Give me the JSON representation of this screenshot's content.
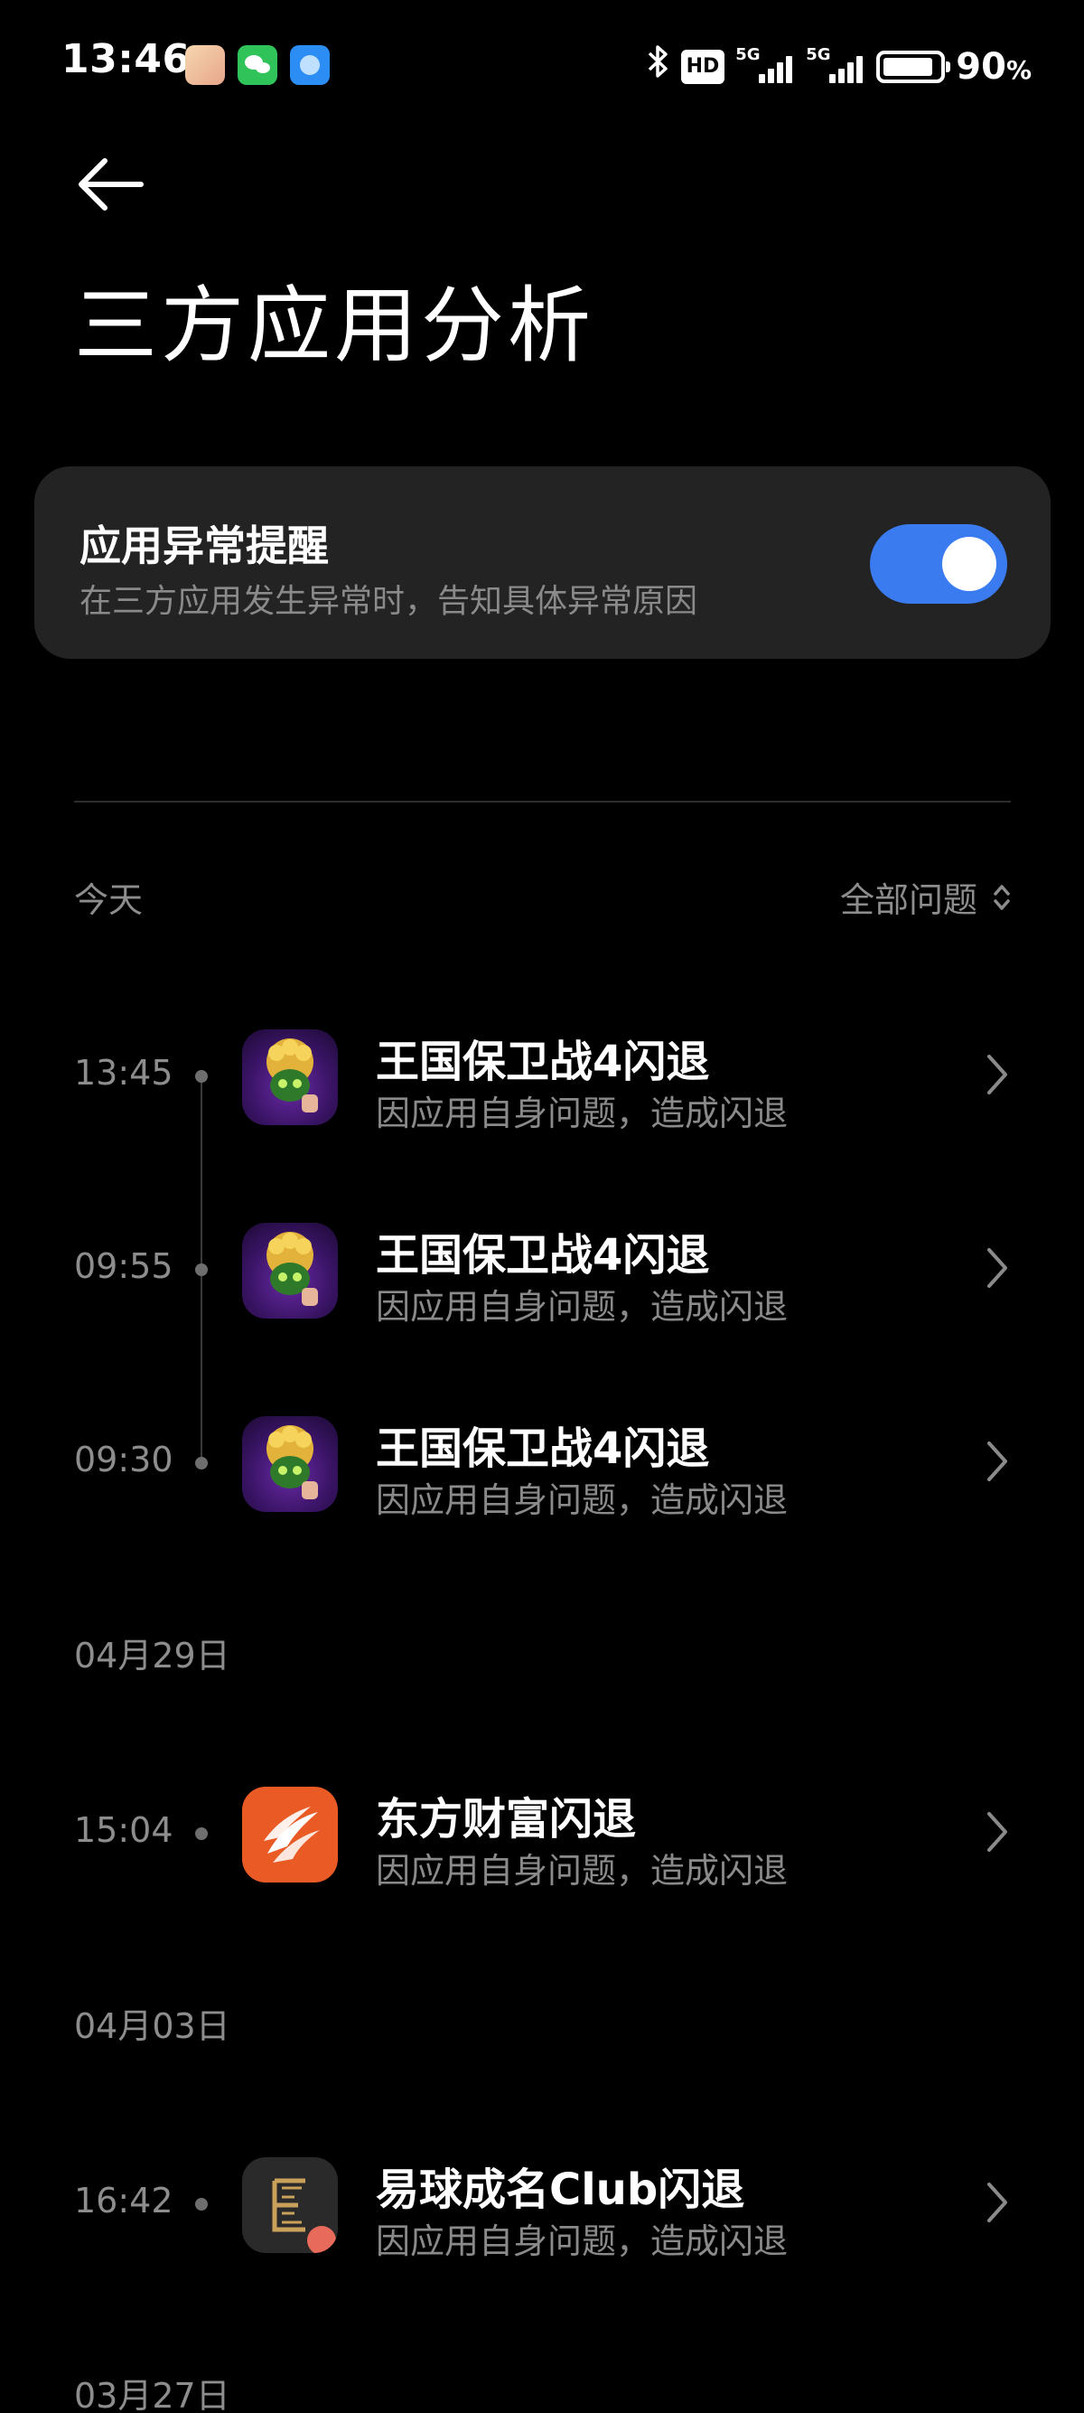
{
  "status_bar": {
    "time": "13:46",
    "hd_label": "HD",
    "signal1_label": "5G",
    "signal2_label": "5G",
    "battery_text": "90",
    "battery_unit": "%",
    "battery_level": 0.9
  },
  "header": {
    "title": "三方应用分析"
  },
  "setting": {
    "title": "应用异常提醒",
    "subtitle": "在三方应用发生异常时，告知具体异常原因",
    "enabled": true
  },
  "filter": {
    "label": "全部问题"
  },
  "groups": [
    {
      "date": "今天",
      "entries": [
        {
          "time": "13:45",
          "title": "王国保卫战4闪退",
          "subtitle": "因应用自身问题，造成闪退",
          "icon": "kingdom-rush-icon"
        },
        {
          "time": "09:55",
          "title": "王国保卫战4闪退",
          "subtitle": "因应用自身问题，造成闪退",
          "icon": "kingdom-rush-icon"
        },
        {
          "time": "09:30",
          "title": "王国保卫战4闪退",
          "subtitle": "因应用自身问题，造成闪退",
          "icon": "kingdom-rush-icon"
        }
      ]
    },
    {
      "date": "04月29日",
      "entries": [
        {
          "time": "15:04",
          "title": "东方财富闪退",
          "subtitle": "因应用自身问题，造成闪退",
          "icon": "eastmoney-icon"
        }
      ]
    },
    {
      "date": "04月03日",
      "entries": [
        {
          "time": "16:42",
          "title": "易球成名Club闪退",
          "subtitle": "因应用自身问题，造成闪退",
          "icon": "club-icon"
        }
      ]
    },
    {
      "date": "03月27日",
      "entries": []
    }
  ],
  "colors": {
    "background": "#000000",
    "card": "#232323",
    "toggle_on": "#3b7bf0",
    "secondary_text": "#8d8d8d"
  }
}
